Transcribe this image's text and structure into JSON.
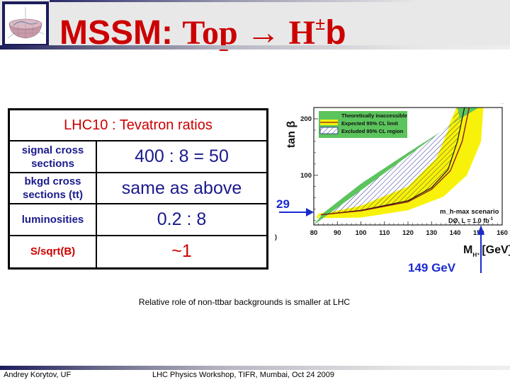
{
  "header": {
    "title_part1": "MSSM: ",
    "title_part2": "Top ",
    "title_arrow": "→",
    "title_part3": " H",
    "title_sup": "±",
    "title_part4": "b",
    "logo_icon": "mexican-hat-potential-icon"
  },
  "table": {
    "title": "LHC10 : Tevatron  ratios",
    "rows": [
      {
        "label_line1": "signal cross",
        "label_line2": "sections",
        "value": "400 : 8 = 50"
      },
      {
        "label_line1": "bkgd cross",
        "label_line2": "sections (tt)",
        "value": "same as above"
      },
      {
        "label_line1": "luminosities",
        "label_line2": "",
        "value": "0.2 : 8"
      },
      {
        "label_line1": "S/sqrt(B)",
        "label_line2": "",
        "value": "~1"
      }
    ]
  },
  "note": "Relative role of non-ttbar backgrounds is smaller at LHC",
  "footer": {
    "author": "Andrey Korytov, UF",
    "event": "LHC Physics Workshop, TIFR, Mumbai, Oct 24 2009"
  },
  "plot": {
    "ylabel": "tan β",
    "xlabel_main": "M",
    "xlabel_sub": "H⁺",
    "xlabel_unit": "[GeV]",
    "xticks": [
      "80",
      "90",
      "100",
      "110",
      "120",
      "130",
      "140",
      "150",
      "160"
    ],
    "yticks": [
      "100",
      "200"
    ],
    "legend": [
      {
        "label": "Theoretically inaccessible",
        "color": "#5cc45c"
      },
      {
        "label": "Expected 95% CL limit",
        "color": "#f5f000"
      },
      {
        "label": "Excluded 95% CL region",
        "color": "#2a2a8c"
      }
    ],
    "scenario": "m_h-max scenario",
    "lumi": "DØ, L = 1.0 fb",
    "lumi_sup": "-1",
    "annot_y_value": "29",
    "annot_x_value": "149 GeV",
    "left_clip_label": ")",
    "colors": {
      "green": "#5cc45c",
      "yellow": "#f8f20a",
      "hatch": "#2a2a8c",
      "limit": "#8b1a1a",
      "arrow": "#1a2ad0"
    }
  },
  "chart_data": {
    "type": "area",
    "title": "",
    "xlabel": "M_H+ [GeV]",
    "ylabel": "tan β",
    "xlim": [
      80,
      160
    ],
    "ylim": [
      12,
      220
    ],
    "xticks": [
      80,
      90,
      100,
      110,
      120,
      130,
      140,
      150,
      160
    ],
    "yticks": [
      100,
      200
    ],
    "legend_position": "top-left",
    "series": [
      {
        "name": "Theoretically inaccessible (lower boundary)",
        "x": [
          80,
          84,
          100,
          120,
          135,
          142,
          150
        ],
        "y": [
          12,
          33,
          85,
          140,
          180,
          200,
          220
        ]
      },
      {
        "name": "Excluded 95% CL region boundary (observed)",
        "x": [
          83,
          100,
          120,
          130,
          137,
          141,
          144
        ],
        "y": [
          30,
          38,
          55,
          78,
          110,
          160,
          220
        ]
      },
      {
        "name": "Expected 95% CL limit",
        "x": [
          83,
          100,
          120,
          130,
          138,
          143,
          146
        ],
        "y": [
          30,
          37,
          53,
          75,
          108,
          160,
          220
        ]
      }
    ],
    "annotations": [
      {
        "text": "29",
        "type": "arrow",
        "axis": "y",
        "value": 29
      },
      {
        "text": "149 GeV",
        "type": "arrow",
        "axis": "x",
        "value": 149
      },
      {
        "text": "m_h-max scenario"
      },
      {
        "text": "DØ, L = 1.0 fb^-1"
      }
    ]
  }
}
